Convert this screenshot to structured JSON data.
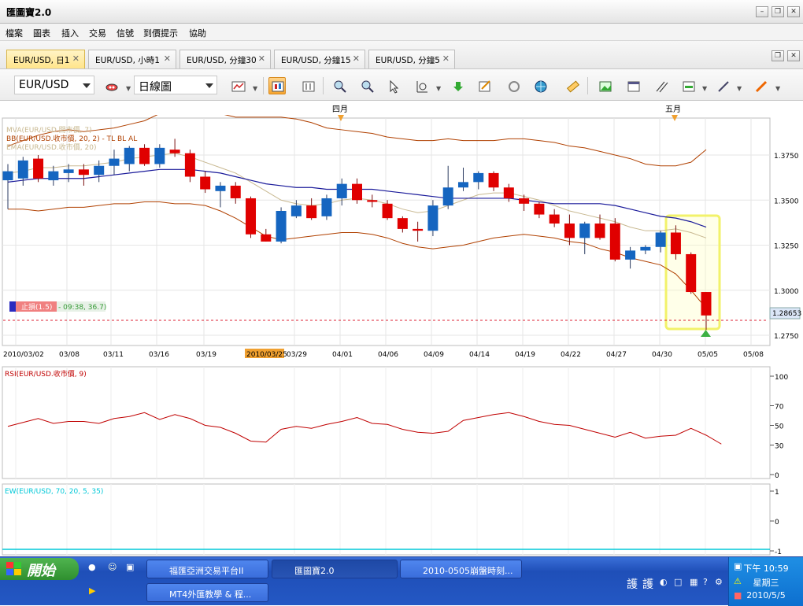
{
  "window": {
    "title": "匯圖寶2.0"
  },
  "menu": [
    "檔案",
    "圖表",
    "插入",
    "交易",
    "信號",
    "到價提示",
    "協助"
  ],
  "tabs": [
    {
      "label": "EUR/USD, 日1",
      "active": true
    },
    {
      "label": "EUR/USD, 小時1",
      "active": false
    },
    {
      "label": "EUR/USD, 分鐘30",
      "active": false
    },
    {
      "label": "EUR/USD, 分鐘15",
      "active": false
    },
    {
      "label": "EUR/USD, 分鐘5",
      "active": false
    }
  ],
  "toolbar": {
    "symbol": "EUR/USD",
    "timeframe": "日線圖"
  },
  "months": [
    "四月",
    "五月"
  ],
  "indicators": {
    "mva": "MVA(EUR/USD.開市價, 7)",
    "bb": "BB(EUR/USD.收市價, 20, 2) - TL  BL  AL",
    "ema": "EMA(EUR/USD.收市價, 20)",
    "stoploss": "止損(1.5)",
    "stoploss_info": "- 09:38, 36.7)",
    "rsi": "RSI(EUR/USD.收市價, 9)",
    "ew": "EW(EUR/USD, 70, 20, 5, 35)"
  },
  "cursor_date": "2010/03/25",
  "current_price": "1.28653",
  "colors": {
    "up": "#1565c0",
    "down": "#e00000",
    "bb": "#b04000",
    "ma": "#1a1a9a",
    "ema": "#c8b890",
    "rsi": "#c00000",
    "ew": "#00c8d8",
    "highlight": "#ffff70"
  },
  "chart_data": {
    "type": "candlestick",
    "price_ticks": [
      "1.3750",
      "1.3500",
      "1.3250",
      "1.3000",
      "1.2750"
    ],
    "date_ticks": [
      "2010/03/02",
      "03/08",
      "03/11",
      "03/16",
      "03/19",
      "03/29",
      "04/01",
      "04/06",
      "04/09",
      "04/14",
      "04/19",
      "04/22",
      "04/27",
      "04/30",
      "05/05",
      "05/08"
    ],
    "candles": [
      {
        "o": 1.361,
        "h": 1.37,
        "l": 1.345,
        "c": 1.366
      },
      {
        "o": 1.362,
        "h": 1.374,
        "l": 1.358,
        "c": 1.372
      },
      {
        "o": 1.373,
        "h": 1.375,
        "l": 1.36,
        "c": 1.362
      },
      {
        "o": 1.361,
        "h": 1.369,
        "l": 1.358,
        "c": 1.366
      },
      {
        "o": 1.365,
        "h": 1.37,
        "l": 1.36,
        "c": 1.367
      },
      {
        "o": 1.367,
        "h": 1.37,
        "l": 1.358,
        "c": 1.364
      },
      {
        "o": 1.364,
        "h": 1.372,
        "l": 1.36,
        "c": 1.369
      },
      {
        "o": 1.369,
        "h": 1.378,
        "l": 1.364,
        "c": 1.373
      },
      {
        "o": 1.37,
        "h": 1.38,
        "l": 1.366,
        "c": 1.379
      },
      {
        "o": 1.379,
        "h": 1.381,
        "l": 1.369,
        "c": 1.37
      },
      {
        "o": 1.37,
        "h": 1.381,
        "l": 1.368,
        "c": 1.379
      },
      {
        "o": 1.378,
        "h": 1.384,
        "l": 1.374,
        "c": 1.376
      },
      {
        "o": 1.376,
        "h": 1.378,
        "l": 1.36,
        "c": 1.363
      },
      {
        "o": 1.363,
        "h": 1.366,
        "l": 1.354,
        "c": 1.356
      },
      {
        "o": 1.355,
        "h": 1.36,
        "l": 1.346,
        "c": 1.358
      },
      {
        "o": 1.358,
        "h": 1.36,
        "l": 1.348,
        "c": 1.351
      },
      {
        "o": 1.351,
        "h": 1.352,
        "l": 1.329,
        "c": 1.331
      },
      {
        "o": 1.331,
        "h": 1.334,
        "l": 1.327,
        "c": 1.327
      },
      {
        "o": 1.327,
        "h": 1.346,
        "l": 1.326,
        "c": 1.344
      },
      {
        "o": 1.341,
        "h": 1.35,
        "l": 1.34,
        "c": 1.347
      },
      {
        "o": 1.347,
        "h": 1.351,
        "l": 1.339,
        "c": 1.34
      },
      {
        "o": 1.341,
        "h": 1.353,
        "l": 1.339,
        "c": 1.351
      },
      {
        "o": 1.351,
        "h": 1.362,
        "l": 1.347,
        "c": 1.359
      },
      {
        "o": 1.359,
        "h": 1.362,
        "l": 1.348,
        "c": 1.35
      },
      {
        "o": 1.35,
        "h": 1.353,
        "l": 1.346,
        "c": 1.349
      },
      {
        "o": 1.348,
        "h": 1.35,
        "l": 1.339,
        "c": 1.34
      },
      {
        "o": 1.34,
        "h": 1.341,
        "l": 1.332,
        "c": 1.334
      },
      {
        "o": 1.334,
        "h": 1.338,
        "l": 1.327,
        "c": 1.333
      },
      {
        "o": 1.333,
        "h": 1.35,
        "l": 1.33,
        "c": 1.347
      },
      {
        "o": 1.347,
        "h": 1.369,
        "l": 1.345,
        "c": 1.357
      },
      {
        "o": 1.357,
        "h": 1.368,
        "l": 1.355,
        "c": 1.36
      },
      {
        "o": 1.36,
        "h": 1.366,
        "l": 1.356,
        "c": 1.365
      },
      {
        "o": 1.365,
        "h": 1.366,
        "l": 1.355,
        "c": 1.357
      },
      {
        "o": 1.357,
        "h": 1.359,
        "l": 1.349,
        "c": 1.351
      },
      {
        "o": 1.351,
        "h": 1.353,
        "l": 1.344,
        "c": 1.348
      },
      {
        "o": 1.348,
        "h": 1.349,
        "l": 1.34,
        "c": 1.342
      },
      {
        "o": 1.342,
        "h": 1.345,
        "l": 1.335,
        "c": 1.337
      },
      {
        "o": 1.337,
        "h": 1.342,
        "l": 1.325,
        "c": 1.329
      },
      {
        "o": 1.329,
        "h": 1.338,
        "l": 1.32,
        "c": 1.337
      },
      {
        "o": 1.337,
        "h": 1.342,
        "l": 1.328,
        "c": 1.329
      },
      {
        "o": 1.337,
        "h": 1.34,
        "l": 1.316,
        "c": 1.317
      },
      {
        "o": 1.317,
        "h": 1.324,
        "l": 1.312,
        "c": 1.322
      },
      {
        "o": 1.322,
        "h": 1.325,
        "l": 1.32,
        "c": 1.324
      },
      {
        "o": 1.324,
        "h": 1.333,
        "l": 1.321,
        "c": 1.332
      },
      {
        "o": 1.332,
        "h": 1.336,
        "l": 1.317,
        "c": 1.32
      },
      {
        "o": 1.32,
        "h": 1.321,
        "l": 1.298,
        "c": 1.299
      },
      {
        "o": 1.299,
        "h": 1.299,
        "l": 1.278,
        "c": 1.286
      }
    ],
    "bb_upper": [
      1.38,
      1.383,
      1.386,
      1.388,
      1.389,
      1.388,
      1.389,
      1.39,
      1.392,
      1.394,
      1.398,
      1.4,
      1.4,
      1.399,
      1.398,
      1.396,
      1.396,
      1.396,
      1.396,
      1.395,
      1.393,
      1.39,
      1.389,
      1.388,
      1.387,
      1.385,
      1.384,
      1.383,
      1.383,
      1.384,
      1.383,
      1.383,
      1.383,
      1.384,
      1.384,
      1.383,
      1.382,
      1.38,
      1.379,
      1.377,
      1.375,
      1.373,
      1.37,
      1.369,
      1.369,
      1.371,
      1.378
    ],
    "bb_lower": [
      1.345,
      1.345,
      1.344,
      1.345,
      1.346,
      1.346,
      1.347,
      1.348,
      1.348,
      1.349,
      1.349,
      1.348,
      1.348,
      1.347,
      1.344,
      1.34,
      1.335,
      1.33,
      1.328,
      1.329,
      1.33,
      1.331,
      1.332,
      1.332,
      1.331,
      1.329,
      1.326,
      1.324,
      1.323,
      1.324,
      1.325,
      1.327,
      1.329,
      1.33,
      1.331,
      1.33,
      1.329,
      1.327,
      1.326,
      1.323,
      1.321,
      1.318,
      1.316,
      1.314,
      1.309,
      1.3,
      1.29
    ],
    "ma_line": [
      1.36,
      1.361,
      1.362,
      1.362,
      1.362,
      1.362,
      1.363,
      1.364,
      1.365,
      1.366,
      1.367,
      1.367,
      1.367,
      1.366,
      1.365,
      1.363,
      1.361,
      1.359,
      1.358,
      1.357,
      1.357,
      1.356,
      1.356,
      1.356,
      1.356,
      1.355,
      1.354,
      1.353,
      1.352,
      1.351,
      1.351,
      1.351,
      1.351,
      1.351,
      1.35,
      1.349,
      1.348,
      1.348,
      1.348,
      1.348,
      1.347,
      1.345,
      1.343,
      1.341,
      1.34,
      1.338,
      1.335
    ],
    "ema_line": [
      1.365,
      1.366,
      1.368,
      1.368,
      1.369,
      1.369,
      1.37,
      1.371,
      1.373,
      1.374,
      1.375,
      1.376,
      1.374,
      1.371,
      1.368,
      1.365,
      1.36,
      1.355,
      1.35,
      1.348,
      1.347,
      1.348,
      1.35,
      1.351,
      1.35,
      1.348,
      1.345,
      1.343,
      1.344,
      1.347,
      1.35,
      1.353,
      1.354,
      1.354,
      1.352,
      1.35,
      1.347,
      1.344,
      1.342,
      1.34,
      1.338,
      1.335,
      1.333,
      1.333,
      1.334,
      1.332,
      1.329
    ],
    "rsi_ticks": [
      "100",
      "70",
      "50",
      "30",
      "0"
    ],
    "rsi": [
      49,
      53,
      57,
      52,
      54,
      54,
      52,
      57,
      59,
      63,
      56,
      61,
      57,
      50,
      48,
      42,
      34,
      33,
      46,
      49,
      47,
      51,
      54,
      58,
      52,
      51,
      46,
      43,
      42,
      44,
      55,
      58,
      61,
      63,
      59,
      54,
      51,
      50,
      46,
      42,
      38,
      43,
      37,
      39,
      40,
      47,
      40,
      31
    ],
    "ew_ticks": [
      "1",
      "0",
      "-1"
    ]
  },
  "taskbar": {
    "start": "開始",
    "items": [
      "福匯亞洲交易平台II",
      "匯圖寶2.0",
      "2010-0505崩盤時刻...",
      "MT4外匯教學 & 程..."
    ],
    "clock": {
      "time": "下午 10:59",
      "weekday": "星期三",
      "date": "2010/5/5"
    }
  }
}
